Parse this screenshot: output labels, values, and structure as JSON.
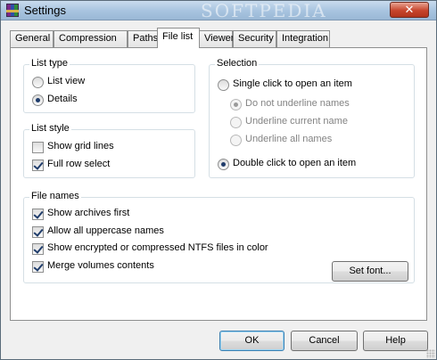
{
  "window": {
    "title": "Settings",
    "watermark": "SOFTPEDIA",
    "close_label": "✕"
  },
  "tabs": [
    {
      "label": "General"
    },
    {
      "label": "Compression"
    },
    {
      "label": "Paths"
    },
    {
      "label": "File list"
    },
    {
      "label": "Viewer"
    },
    {
      "label": "Security"
    },
    {
      "label": "Integration"
    }
  ],
  "list_type": {
    "title": "List type",
    "options": [
      {
        "label": "List view",
        "selected": false
      },
      {
        "label": "Details",
        "selected": true
      }
    ]
  },
  "list_style": {
    "title": "List style",
    "options": [
      {
        "label": "Show grid lines",
        "checked": false
      },
      {
        "label": "Full row select",
        "checked": true
      }
    ]
  },
  "selection": {
    "title": "Selection",
    "single_click": {
      "label": "Single click to open an item",
      "selected": false
    },
    "underline_options": [
      {
        "label": "Do not underline names",
        "selected": true,
        "enabled": false
      },
      {
        "label": "Underline current name",
        "selected": false,
        "enabled": false
      },
      {
        "label": "Underline all names",
        "selected": false,
        "enabled": false
      }
    ],
    "double_click": {
      "label": "Double click to open an item",
      "selected": true
    }
  },
  "file_names": {
    "title": "File names",
    "options": [
      {
        "label": "Show archives first",
        "checked": true
      },
      {
        "label": "Allow all uppercase names",
        "checked": true
      },
      {
        "label": "Show encrypted or compressed NTFS files in color",
        "checked": true
      },
      {
        "label": "Merge volumes contents",
        "checked": true
      }
    ],
    "set_font_label": "Set font..."
  },
  "buttons": {
    "ok": "OK",
    "cancel": "Cancel",
    "help": "Help"
  }
}
